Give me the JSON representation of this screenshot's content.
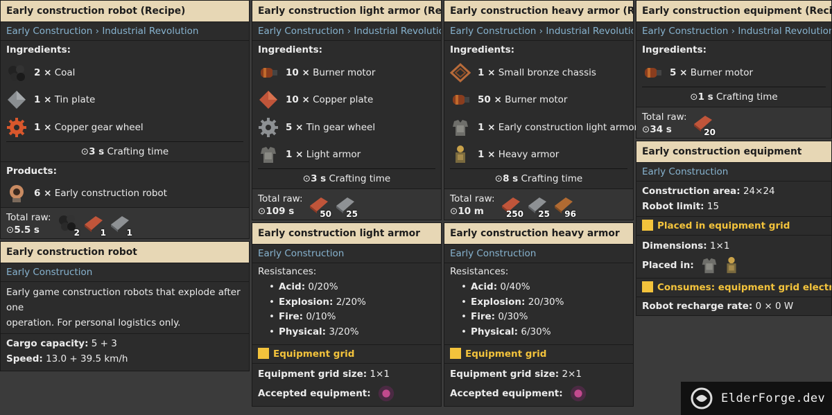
{
  "col1": {
    "recipe_title": "Early construction robot (Recipe)",
    "breadcrumb": [
      "Early Construction",
      "Industrial Revolution"
    ],
    "ingredients_label": "Ingredients:",
    "ingredients": [
      {
        "qty": "2 ×",
        "name": "Coal",
        "icon": "coal-icon"
      },
      {
        "qty": "1 ×",
        "name": "Tin plate",
        "icon": "tin-plate-icon"
      },
      {
        "qty": "1 ×",
        "name": "Copper gear wheel",
        "icon": "copper-gear-icon"
      }
    ],
    "crafting_time": "3 s",
    "crafting_label": "Crafting time",
    "products_label": "Products:",
    "product": {
      "qty": "6 ×",
      "name": "Early construction robot"
    },
    "total_raw_label": "Total raw:",
    "total_raw_time": "5.5 s",
    "raw": [
      {
        "icon": "coal-icon",
        "count": "2"
      },
      {
        "icon": "copper-plate-icon",
        "count": "1"
      },
      {
        "icon": "tin-plate-icon",
        "count": "1"
      }
    ],
    "item_title": "Early construction robot",
    "item_mod": "Early Construction",
    "description_1": "Early game construction robots that explode after one",
    "description_2": "operation. For personal logistics only.",
    "cargo_label": "Cargo capacity:",
    "cargo_value": "5 + 3",
    "speed_label": "Speed:",
    "speed_value": "13.0 + 39.5  km/h"
  },
  "col2": {
    "recipe_title": "Early construction light armor (Recipe)",
    "breadcrumb": [
      "Early Construction",
      "Industrial Revolution"
    ],
    "ingredients_label": "Ingredients:",
    "ingredients": [
      {
        "qty": "10 ×",
        "name": "Burner motor",
        "icon": "burner-motor-icon"
      },
      {
        "qty": "10 ×",
        "name": "Copper plate",
        "icon": "copper-plate-icon"
      },
      {
        "qty": "5 ×",
        "name": "Tin gear wheel",
        "icon": "tin-gear-icon"
      },
      {
        "qty": "1 ×",
        "name": "Light armor",
        "icon": "light-armor-icon"
      }
    ],
    "crafting_time": "3 s",
    "crafting_label": "Crafting time",
    "total_raw_label": "Total raw:",
    "total_raw_time": "109 s",
    "raw": [
      {
        "icon": "copper-plate-icon",
        "count": "50"
      },
      {
        "icon": "tin-plate-icon",
        "count": "25"
      }
    ],
    "item_title": "Early construction light armor",
    "item_mod": "Early Construction",
    "resistances_label": "Resistances:",
    "resistances": [
      {
        "name": "Acid:",
        "value": "0/20%"
      },
      {
        "name": "Explosion:",
        "value": "2/20%"
      },
      {
        "name": "Fire:",
        "value": "0/10%"
      },
      {
        "name": "Physical:",
        "value": "3/20%"
      }
    ],
    "grid_title": "Equipment grid",
    "grid_size_label": "Equipment grid size:",
    "grid_size_value": "1×1",
    "accepted_label": "Accepted equipment:"
  },
  "col3": {
    "recipe_title": "Early construction heavy armor (Recipe)",
    "breadcrumb": [
      "Early Construction",
      "Industrial Revolution"
    ],
    "ingredients_label": "Ingredients:",
    "ingredients": [
      {
        "qty": "1 ×",
        "name": "Small bronze chassis",
        "icon": "bronze-chassis-icon"
      },
      {
        "qty": "50 ×",
        "name": "Burner motor",
        "icon": "burner-motor-icon"
      },
      {
        "qty": "1 ×",
        "name": "Early construction light armor",
        "icon": "light-armor-icon"
      },
      {
        "qty": "1 ×",
        "name": "Heavy armor",
        "icon": "heavy-armor-icon"
      }
    ],
    "crafting_time": "8 s",
    "crafting_label": "Crafting time",
    "total_raw_label": "Total raw:",
    "total_raw_time": "10 m",
    "raw": [
      {
        "icon": "copper-plate-icon",
        "count": "250"
      },
      {
        "icon": "tin-plate-icon",
        "count": "25"
      },
      {
        "icon": "bronze-plate-icon",
        "count": "96"
      }
    ],
    "item_title": "Early construction heavy armor",
    "item_mod": "Early Construction",
    "resistances_label": "Resistances:",
    "resistances": [
      {
        "name": "Acid:",
        "value": "0/40%"
      },
      {
        "name": "Explosion:",
        "value": "20/30%"
      },
      {
        "name": "Fire:",
        "value": "0/30%"
      },
      {
        "name": "Physical:",
        "value": "6/30%"
      }
    ],
    "grid_title": "Equipment grid",
    "grid_size_label": "Equipment grid size:",
    "grid_size_value": "2×1",
    "accepted_label": "Accepted equipment:"
  },
  "col4": {
    "recipe_title": "Early construction equipment (Recipe)",
    "breadcrumb": [
      "Early Construction",
      "Industrial Revolution"
    ],
    "ingredients_label": "Ingredients:",
    "ingredients": [
      {
        "qty": "5 ×",
        "name": "Burner motor",
        "icon": "burner-motor-icon"
      }
    ],
    "crafting_time": "1 s",
    "crafting_label": "Crafting time",
    "total_raw_label": "Total raw:",
    "total_raw_time": "34 s",
    "raw": [
      {
        "icon": "copper-plate-icon",
        "count": "20"
      }
    ],
    "item_title": "Early construction equipment",
    "item_mod": "Early Construction",
    "area_label": "Construction area:",
    "area_value": "24×24",
    "limit_label": "Robot limit:",
    "limit_value": "15",
    "placed_title": "Placed in equipment grid",
    "dimensions_label": "Dimensions:",
    "dimensions_value": "1×1",
    "placed_in_label": "Placed in:",
    "consumes_title": "Consumes: equipment grid electricity",
    "recharge_label": "Robot recharge rate:",
    "recharge_value": "0 × 0 W"
  },
  "watermark": "ElderForge.dev",
  "colors": {
    "header_bg": "#e7d7b5",
    "mod_link": "#87b3cf",
    "accent_gold": "#f3c33c",
    "panel_bg": "#2c2c2c"
  }
}
